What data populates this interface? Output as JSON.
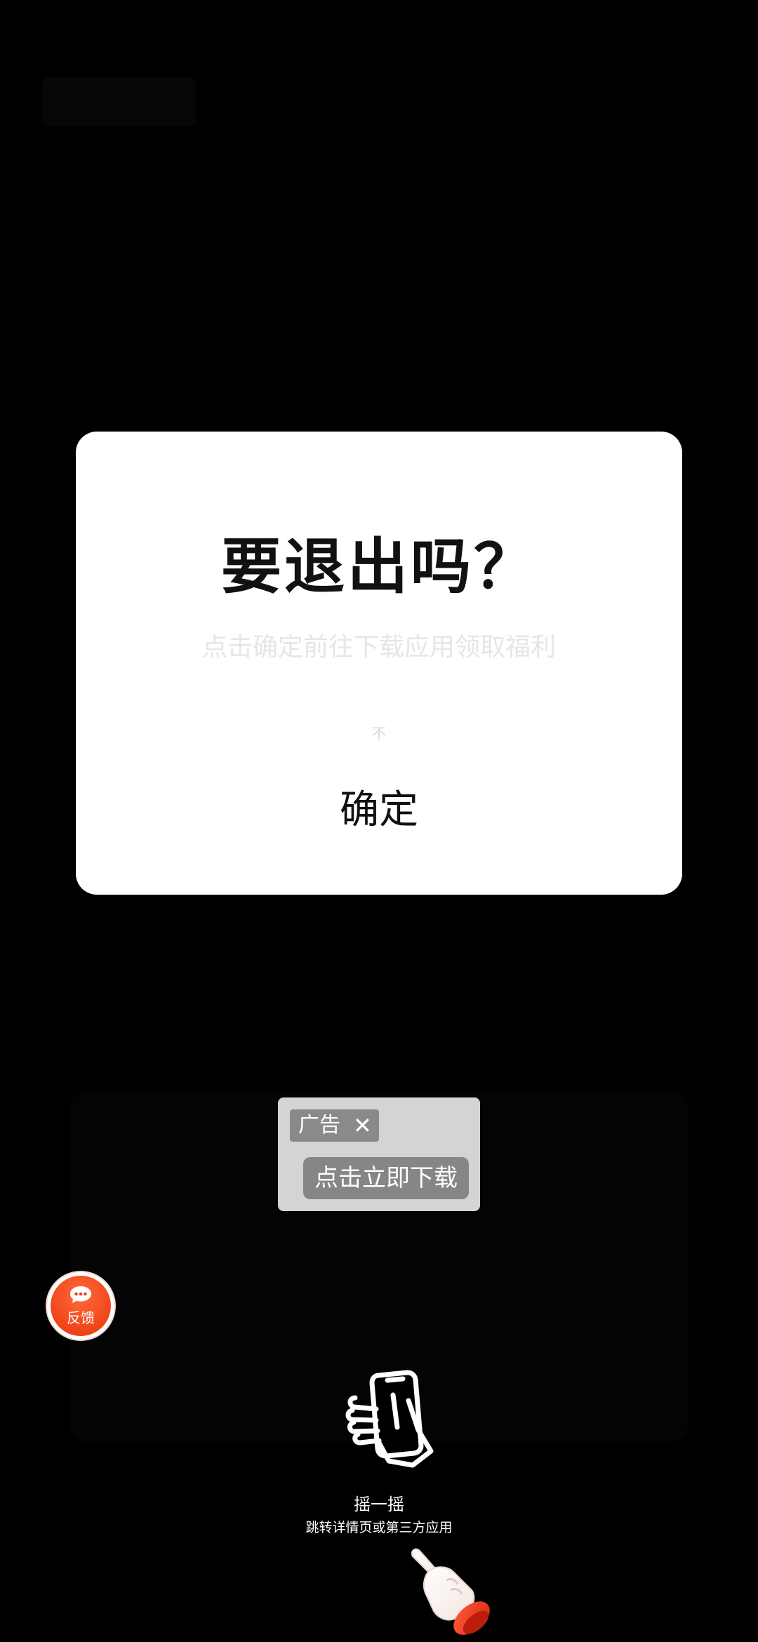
{
  "dialog": {
    "title": "要退出吗？",
    "subtitle": "点击确定前往下载应用领取福利",
    "cancel_label": "不",
    "confirm_label": "确定"
  },
  "ad": {
    "tag_label": "广告",
    "close_glyph": "✕",
    "cta_label": "点击立即下载"
  },
  "feedback": {
    "label": "反馈",
    "icon": "chat-bubble-icon",
    "color": "#f04418"
  },
  "shake": {
    "title": "摇一摇",
    "subtitle": "跳转详情页或第三方应用",
    "icon": "shake-phone-icon",
    "pointer_icon": "pointing-hand-icon"
  }
}
